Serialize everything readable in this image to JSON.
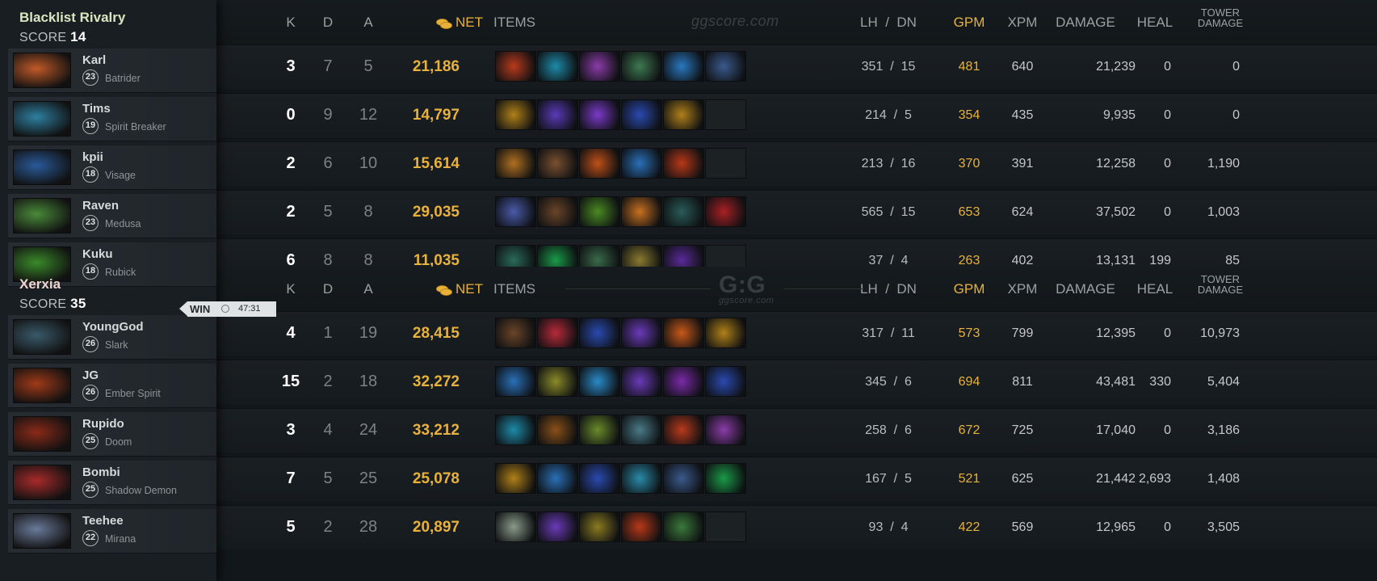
{
  "headers": {
    "k": "K",
    "d": "D",
    "a": "A",
    "net": "NET",
    "items": "ITEMS",
    "lh_dn": "LH  /  DN",
    "gpm": "GPM",
    "xpm": "XPM",
    "damage": "DAMAGE",
    "heal": "HEAL",
    "tower_line1": "TOWER",
    "tower_line2": "DAMAGE"
  },
  "watermarks": {
    "top": "ggscore.com",
    "logo": "G:G",
    "logo_sub": "ggscore.com"
  },
  "teams": [
    {
      "name": "Blacklist Rivalry",
      "name_color": "#d9e6bf",
      "score_label": "SCORE",
      "score": "14",
      "players": [
        {
          "name": "Karl",
          "level": "23",
          "hero": "Batrider",
          "k": "3",
          "d": "7",
          "a": "5",
          "net": "21,186",
          "lh_dn": "351  /  15",
          "gpm": "481",
          "xpm": "640",
          "damage": "21,239",
          "heal": "0",
          "tower": "0",
          "items": [
            "#b83a1c",
            "#1e8aa8",
            "#8a3ca8",
            "#3e7a52",
            "#2a78c0",
            "#3a5a8c"
          ]
        },
        {
          "name": "Tims",
          "level": "19",
          "hero": "Spirit Breaker",
          "k": "0",
          "d": "9",
          "a": "12",
          "net": "14,797",
          "lh_dn": "214  /  5",
          "gpm": "354",
          "xpm": "435",
          "damage": "9,935",
          "heal": "0",
          "tower": "0",
          "items": [
            "#b08018",
            "#5a3ab8",
            "#7a3ac8",
            "#2a4ab0",
            "#b0801a",
            ""
          ]
        },
        {
          "name": "kpii",
          "level": "18",
          "hero": "Visage",
          "k": "2",
          "d": "6",
          "a": "10",
          "net": "15,614",
          "lh_dn": "213  /  16",
          "gpm": "370",
          "xpm": "391",
          "damage": "12,258",
          "heal": "0",
          "tower": "1,190",
          "items": [
            "#b07020",
            "#7a5030",
            "#c05018",
            "#2a70b8",
            "#b83818",
            ""
          ]
        },
        {
          "name": "Raven",
          "level": "23",
          "hero": "Medusa",
          "k": "2",
          "d": "5",
          "a": "8",
          "net": "29,035",
          "lh_dn": "565  /  15",
          "gpm": "653",
          "xpm": "624",
          "damage": "37,502",
          "heal": "0",
          "tower": "1,003",
          "items": [
            "#4a5aa8",
            "#6a4428",
            "#4a8a22",
            "#c87020",
            "#2a5a58",
            "#a82024"
          ]
        },
        {
          "name": "Kuku",
          "level": "18",
          "hero": "Rubick",
          "k": "6",
          "d": "8",
          "a": "8",
          "net": "11,035",
          "lh_dn": "37  /  4",
          "gpm": "263",
          "xpm": "402",
          "damage": "13,131",
          "heal": "199",
          "tower": "85",
          "items": [
            "#2a6a58",
            "#1a9a48",
            "#3a6a4a",
            "#8a7a30",
            "#5a2a98",
            ""
          ]
        }
      ]
    },
    {
      "name": "Xerxia",
      "name_color": "#f0d6d0",
      "score_label": "SCORE",
      "score": "35",
      "win_label": "WIN",
      "duration": "47:31",
      "players": [
        {
          "name": "YoungGod",
          "level": "26",
          "hero": "Slark",
          "k": "4",
          "d": "1",
          "a": "19",
          "net": "28,415",
          "lh_dn": "317  /  11",
          "gpm": "573",
          "xpm": "799",
          "damage": "12,395",
          "heal": "0",
          "tower": "10,973",
          "items": [
            "#6a4428",
            "#b82a3a",
            "#2a4ab0",
            "#6a3ab8",
            "#c85818",
            "#b08018"
          ]
        },
        {
          "name": "JG",
          "level": "26",
          "hero": "Ember Spirit",
          "k": "15",
          "d": "2",
          "a": "18",
          "net": "32,272",
          "lh_dn": "345  /  6",
          "gpm": "694",
          "xpm": "811",
          "damage": "43,481",
          "heal": "330",
          "tower": "5,404",
          "items": [
            "#2a70b8",
            "#8a8a28",
            "#2a8ac8",
            "#6a3ab8",
            "#7a2aa8",
            "#2a4ab0"
          ]
        },
        {
          "name": "Rupido",
          "level": "25",
          "hero": "Doom",
          "k": "3",
          "d": "4",
          "a": "24",
          "net": "33,212",
          "lh_dn": "258  /  6",
          "gpm": "672",
          "xpm": "725",
          "damage": "17,040",
          "heal": "0",
          "tower": "3,186",
          "items": [
            "#1e8aa8",
            "#8a5018",
            "#6a8a2a",
            "#4a7a88",
            "#b83a1c",
            "#8a3ca8"
          ]
        },
        {
          "name": "Bombi",
          "level": "25",
          "hero": "Shadow Demon",
          "k": "7",
          "d": "5",
          "a": "25",
          "net": "25,078",
          "lh_dn": "167  /  5",
          "gpm": "521",
          "xpm": "625",
          "damage": "21,442",
          "heal": "2,693",
          "tower": "1,408",
          "items": [
            "#b08018",
            "#2a70b8",
            "#2a4ab0",
            "#2a8aa8",
            "#3a5a8c",
            "#1a9a48"
          ]
        },
        {
          "name": "Teehee",
          "level": "22",
          "hero": "Mirana",
          "k": "5",
          "d": "2",
          "a": "28",
          "net": "20,897",
          "lh_dn": "93  /  4",
          "gpm": "422",
          "xpm": "569",
          "damage": "12,965",
          "heal": "0",
          "tower": "3,505",
          "items": [
            "#8a9a8a",
            "#6a3ab8",
            "#8a7a20",
            "#b83818",
            "#3a7a3a",
            ""
          ]
        }
      ]
    }
  ]
}
